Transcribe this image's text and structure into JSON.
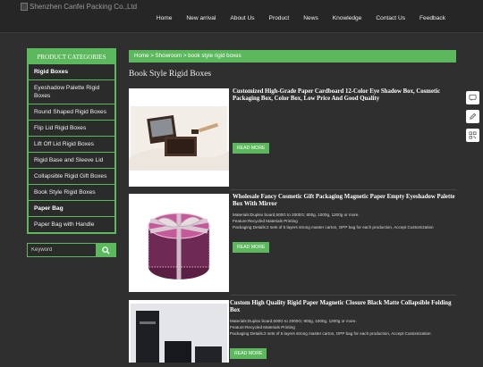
{
  "header": {
    "logo_alt": "Shenzhen Canfei Packing Co.,Ltd",
    "nav": [
      "Home",
      "New arrival",
      "About Us",
      "Product",
      "News",
      "Knowledge",
      "Contact Us",
      "Feedback"
    ]
  },
  "sidebar": {
    "title": "PRODUCT CATEGORIES",
    "items": [
      {
        "label": "Rigid Boxes"
      },
      {
        "label": "Eyeshadow Palette Rigid Boxes"
      },
      {
        "label": "Round Shaped Rigid Boxes"
      },
      {
        "label": "Flip Lid Rigid Boxes"
      },
      {
        "label": "Lift Off Lid Rigid Boxes"
      },
      {
        "label": "Rigid Base and Sleeve Lid"
      },
      {
        "label": "Collapsible Rigid Gift Boxes"
      },
      {
        "label": "Book Style Rigid Boxes"
      },
      {
        "label": "Paper Bag"
      },
      {
        "label": "Paper Bag with Handle"
      }
    ]
  },
  "search": {
    "placeholder": "Keyword"
  },
  "breadcrumb": "Home > Showroom > book style rigid boxes",
  "page_title": "Book Style Rigid Boxes",
  "products": [
    {
      "title": "Customized High-Grade Paper Cardboard 12-Color Eye Shadow Box, Cosmetic Packaging Box, Color Box, Low Price And Good Quality",
      "specs": [],
      "button": "READ MORE"
    },
    {
      "title": "Wholesale Fancy Cosmetic Gift Packaging Magnetic Paper Empty Eyeshadow Palette Box With Mirror",
      "specs": [
        "Materials:Duplex board,500G to 2000G; 800g, 1000g, 1200g or more.",
        "Feature:Recycled Materials Printing",
        "Packaging Details:2 sets of 5 layers strong master carton, OPP bag for each production, Accept Customization"
      ],
      "button": "READ MORE"
    },
    {
      "title": "Custom High Quality Rigid Paper Magnetic Closure Black Matte Collapsible Folding Box",
      "specs": [
        "Materials:Duplex board,500G to 2000G; 800g, 1000g, 1200g or more.",
        "Feature:Recycled Materials Printing",
        "Packaging Details:2 sets of 5 layers strong master carton, OPP bag for each production, Accept Customization"
      ],
      "button": "READ MORE"
    }
  ],
  "tools": [
    "chat-icon",
    "edit-icon",
    "qr-code-icon"
  ]
}
